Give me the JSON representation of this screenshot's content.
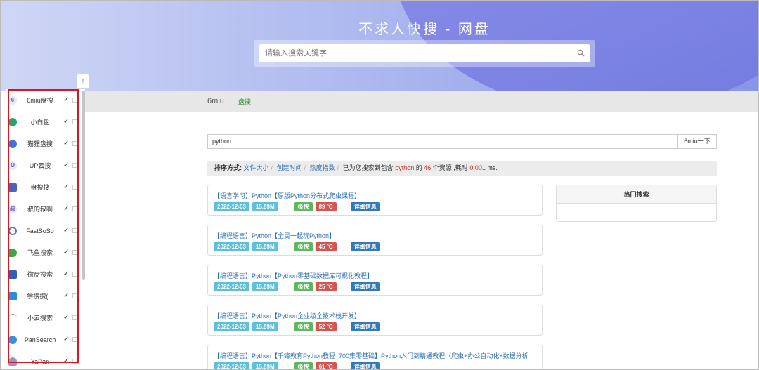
{
  "header": {
    "title": "不求人快搜 - 网盘",
    "search_placeholder": "请输入搜索关键字"
  },
  "sidebar": {
    "up_arrow": "↑",
    "items": [
      {
        "label": "6miu盘搜",
        "icon": "6"
      },
      {
        "label": "小白盘",
        "icon": ""
      },
      {
        "label": "猫狸盘搜",
        "icon": ""
      },
      {
        "label": "UP云搜",
        "icon": "U"
      },
      {
        "label": "盘搜搜",
        "icon": ""
      },
      {
        "label": "叔的叔啊",
        "icon": "叔"
      },
      {
        "label": "FastSoSo",
        "icon": ""
      },
      {
        "label": "飞鱼搜索",
        "icon": ""
      },
      {
        "label": "微盘搜索",
        "icon": ""
      },
      {
        "label": "学搜搜(...",
        "icon": ""
      },
      {
        "label": "小云搜索",
        "icon": ""
      },
      {
        "label": "PanSearch",
        "icon": ""
      },
      {
        "label": "YaPan",
        "icon": ""
      }
    ],
    "check": "✓"
  },
  "nav": {
    "brand": "6miu",
    "active_tab": "盘搜"
  },
  "query": {
    "value": "python",
    "button": "6miu一下"
  },
  "sort": {
    "label": "排序方式:",
    "options": [
      "文件大小",
      "创建时间",
      "热度指数"
    ],
    "summary_prefix": "已为您搜索到包含",
    "keyword": "python",
    "summary_mid": "的",
    "count": "46",
    "summary_mid2": "个资源 ,耗时",
    "time": "0.001",
    "summary_suffix": "ms."
  },
  "results": [
    {
      "title": "【语言学习】Python【原版Python分布式爬虫课程】",
      "date": "2022-12-03",
      "size": "15.89M",
      "speed": "极快",
      "heat": "89 °C",
      "detail": "详细信息"
    },
    {
      "title": "【编程语言】Python【全民一起玩Python】",
      "date": "2022-12-03",
      "size": "15.89M",
      "speed": "极快",
      "heat": "45 °C",
      "detail": "详细信息"
    },
    {
      "title": "【编程语言】Python【Python零基础数据库可视化教程】",
      "date": "2022-12-03",
      "size": "15.89M",
      "speed": "极快",
      "heat": "25 °C",
      "detail": "详细信息"
    },
    {
      "title": "【编程语言】Python【Python企业级全技术栈开发】",
      "date": "2022-12-03",
      "size": "15.89M",
      "speed": "极快",
      "heat": "52 °C",
      "detail": "详细信息"
    },
    {
      "title": "【编程语言】Python【千锋教育Python教程_700集零基础】Python入门到精通教程（爬虫+办公自动化+数据分析",
      "date": "2022-12-03",
      "size": "15.89M",
      "speed": "极快",
      "heat": "61 °C",
      "detail": "详细信息"
    }
  ],
  "hot": {
    "title": "热门搜索"
  },
  "colors": {
    "accent": "#e0141e",
    "link": "#2e6fb5"
  }
}
